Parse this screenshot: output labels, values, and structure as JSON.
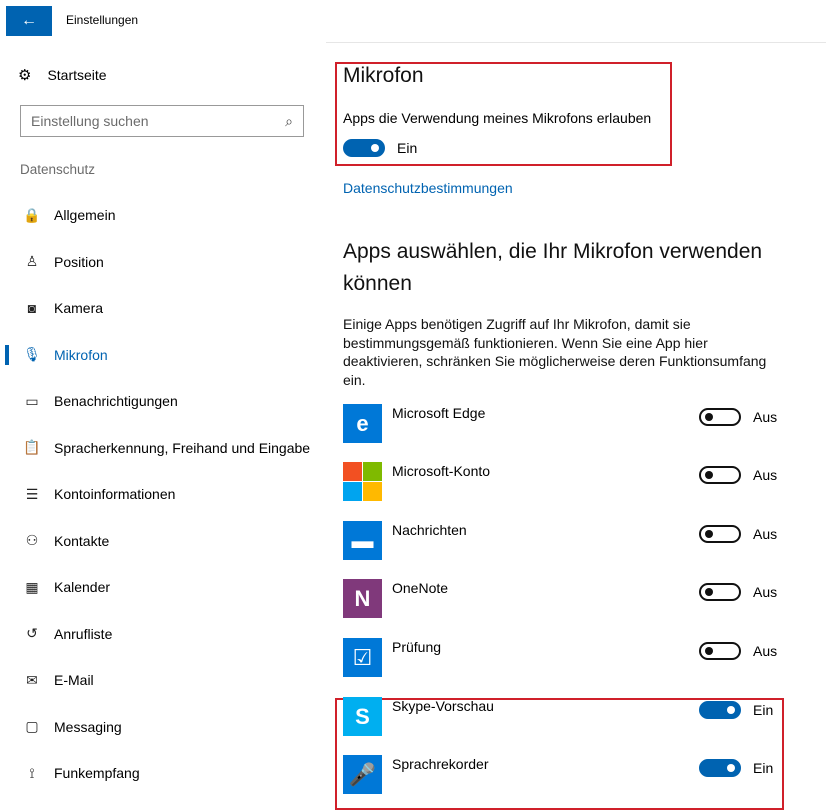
{
  "window": {
    "title": "Einstellungen",
    "back_glyph": "←"
  },
  "sidebar": {
    "home_label": "Startseite",
    "search_placeholder": "Einstellung suchen",
    "section_label": "Datenschutz",
    "items": [
      {
        "label": "Allgemein",
        "icon": "lock-icon",
        "glyph": "🔒"
      },
      {
        "label": "Position",
        "icon": "person-location-icon",
        "glyph": "♙"
      },
      {
        "label": "Kamera",
        "icon": "camera-icon",
        "glyph": "◙"
      },
      {
        "label": "Mikrofon",
        "icon": "microphone-icon",
        "glyph": "🎙"
      },
      {
        "label": "Benachrichtigungen",
        "icon": "notification-icon",
        "glyph": "▭"
      },
      {
        "label": "Spracherkennung, Freihand und Eingabe",
        "icon": "clipboard-icon",
        "glyph": "📋"
      },
      {
        "label": "Kontoinformationen",
        "icon": "account-info-icon",
        "glyph": "☰"
      },
      {
        "label": "Kontakte",
        "icon": "contacts-icon",
        "glyph": "⚇"
      },
      {
        "label": "Kalender",
        "icon": "calendar-icon",
        "glyph": "▦"
      },
      {
        "label": "Anrufliste",
        "icon": "history-icon",
        "glyph": "↺"
      },
      {
        "label": "E-Mail",
        "icon": "mail-icon",
        "glyph": "✉"
      },
      {
        "label": "Messaging",
        "icon": "messaging-icon",
        "glyph": "▢"
      },
      {
        "label": "Funkempfang",
        "icon": "radio-icon",
        "glyph": "⟟"
      }
    ],
    "active_index": 3
  },
  "main": {
    "title": "Mikrofon",
    "allow_label": "Apps die Verwendung meines Mikrofons erlauben",
    "master_toggle": {
      "state": "on",
      "label": "Ein"
    },
    "privacy_link": "Datenschutzbestimmungen",
    "apps_heading": "Apps auswählen, die Ihr Mikrofon verwenden können",
    "apps_description": "Einige Apps benötigen Zugriff auf Ihr Mikrofon, damit sie bestimmungsgemäß funktionieren. Wenn Sie eine App hier deaktivieren, schränken Sie möglicherweise deren Funktionsumfang ein.",
    "apps": [
      {
        "name": "Microsoft Edge",
        "icon": "edge-icon",
        "glyph": "e",
        "color": "#0078d7",
        "state": "off",
        "state_label": "Aus"
      },
      {
        "name": "Microsoft-Konto",
        "icon": "microsoft-logo-icon",
        "glyph": "",
        "color": "#ffffff",
        "state": "off",
        "state_label": "Aus"
      },
      {
        "name": "Nachrichten",
        "icon": "chat-bubble-icon",
        "glyph": "▬",
        "color": "#0078d7",
        "state": "off",
        "state_label": "Aus"
      },
      {
        "name": "OneNote",
        "icon": "onenote-icon",
        "glyph": "N",
        "color": "#80397b",
        "state": "off",
        "state_label": "Aus"
      },
      {
        "name": "Prüfung",
        "icon": "test-icon",
        "glyph": "☑",
        "color": "#0078d7",
        "state": "off",
        "state_label": "Aus"
      },
      {
        "name": "Skype-Vorschau",
        "icon": "skype-icon",
        "glyph": "S",
        "color": "#00aff0",
        "state": "on",
        "state_label": "Ein"
      },
      {
        "name": "Sprachrekorder",
        "icon": "voice-recorder-icon",
        "glyph": "🎤",
        "color": "#0078d7",
        "state": "on",
        "state_label": "Ein"
      }
    ]
  },
  "colors": {
    "accent": "#0063b1",
    "highlight_box": "#d0202a"
  }
}
